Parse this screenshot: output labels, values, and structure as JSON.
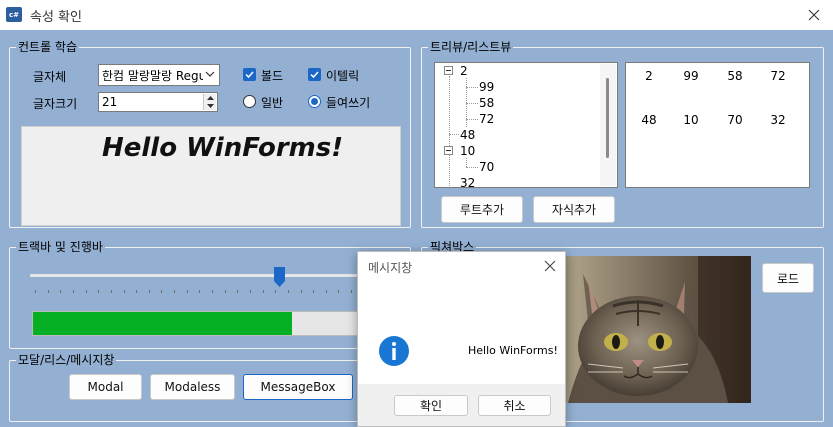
{
  "window": {
    "title": "속성 확인",
    "icon_text": "c#"
  },
  "font_group": {
    "title": "컨트롤 학습",
    "font_label": "글자체",
    "font_value": "한컴 말랑말랑 Regu",
    "size_label": "글자크기",
    "size_value": "21",
    "bold_label": "볼드",
    "bold_checked": true,
    "italic_label": "이텔릭",
    "italic_checked": true,
    "normal_label": "일반",
    "normal_selected": false,
    "indent_label": "들여쓰기",
    "indent_selected": true,
    "preview_text": "Hello WinForms!"
  },
  "tree_group": {
    "title": "트리뷰/리스트뷰",
    "tree_nodes": [
      {
        "text": "2",
        "expanded": true
      },
      {
        "text": "99"
      },
      {
        "text": "58"
      },
      {
        "text": "72"
      },
      {
        "text": "48"
      },
      {
        "text": "10",
        "expanded": true
      },
      {
        "text": "70"
      },
      {
        "text": "32"
      }
    ],
    "list_items": [
      "2",
      "99",
      "58",
      "72",
      "48",
      "10",
      "70",
      "32"
    ],
    "add_root_label": "루트추가",
    "add_child_label": "자식추가"
  },
  "track_group": {
    "title": "트랙바 및 진행바",
    "trackbar_value_fraction": 0.69,
    "progress_fraction": 0.79
  },
  "modal_group": {
    "title": "모달/리스/메시지창",
    "modal_label": "Modal",
    "modeless_label": "Modaless",
    "messagebox_label": "MessageBox"
  },
  "picture_group": {
    "title": "픽쳐박스",
    "load_label": "로드",
    "image_desc": "cat-photo"
  },
  "messagebox": {
    "title": "메시지창",
    "text": "Hello WinForms!",
    "ok_label": "확인",
    "cancel_label": "취소"
  },
  "colors": {
    "form_bg": "#93b0d3",
    "accent": "#1a67c8",
    "progress": "#06b025"
  }
}
